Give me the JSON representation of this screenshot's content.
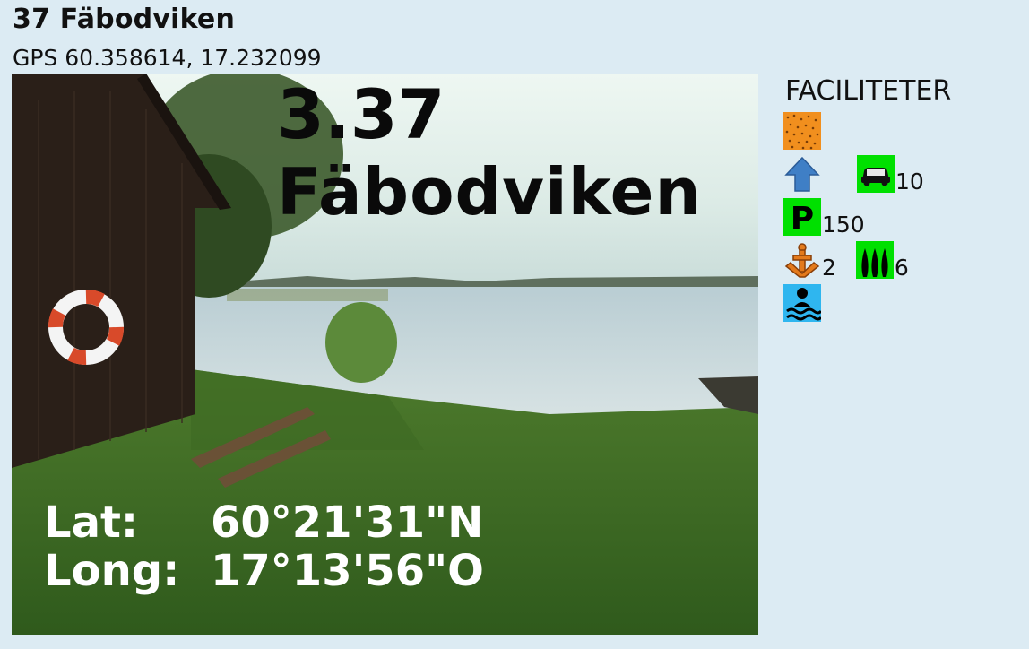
{
  "header": {
    "title": "37 Fäbodviken",
    "gps": "GPS 60.358614, 17.232099"
  },
  "photo": {
    "overlay_number": "3.37",
    "overlay_name": "Fäbodviken",
    "lat_label": "Lat:",
    "lat_value": "60°21'31\"N",
    "long_label": "Long:",
    "long_value": "17°13'56\"O"
  },
  "facilities": {
    "heading": "FACILITETER",
    "rows": [
      [
        {
          "icon": "sand-beach-icon"
        }
      ],
      [
        {
          "icon": "launch-arrow-icon"
        },
        {
          "icon": "car-parking-icon",
          "count": "10",
          "color": "#00e000"
        }
      ],
      [
        {
          "icon": "parking-icon",
          "count": "150",
          "color": "#00e000"
        }
      ],
      [
        {
          "icon": "anchor-icon",
          "count": "2",
          "color": "#e37a1c"
        },
        {
          "icon": "boats-icon",
          "count": "6",
          "color": "#00e000"
        }
      ],
      [
        {
          "icon": "swimming-icon",
          "color": "#2fb6ef"
        }
      ]
    ],
    "counts": {
      "car": "10",
      "parking": "150",
      "anchor": "2",
      "boats": "6"
    }
  }
}
